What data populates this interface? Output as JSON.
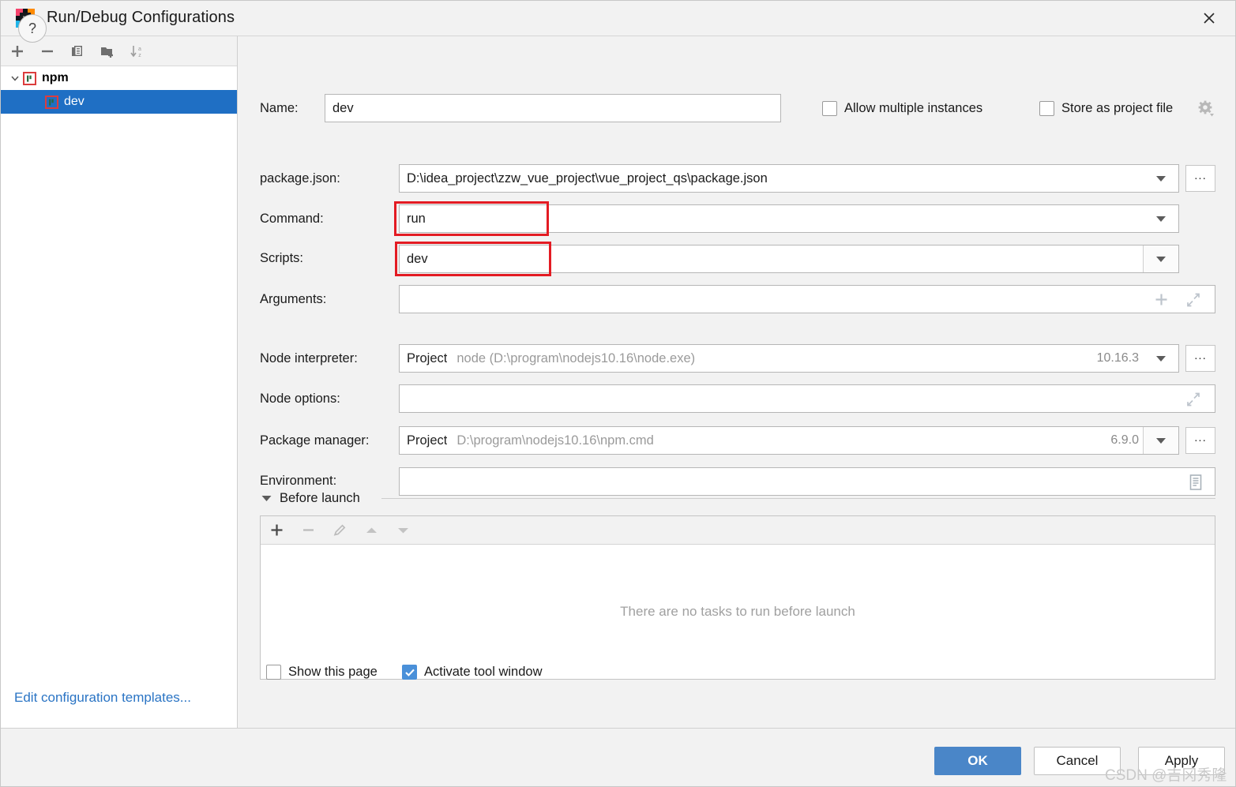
{
  "window": {
    "title": "Run/Debug Configurations",
    "app_icon": "intellij-idea-icon",
    "close_icon": "close-icon"
  },
  "sidebar": {
    "toolbar": [
      {
        "name": "add-configuration-button",
        "icon": "plus-icon"
      },
      {
        "name": "remove-configuration-button",
        "icon": "minus-icon"
      },
      {
        "name": "copy-configuration-button",
        "icon": "copy-icon"
      },
      {
        "name": "new-folder-button",
        "icon": "new-folder-icon"
      },
      {
        "name": "sort-configurations-button",
        "icon": "sort-alphabetically-icon"
      }
    ],
    "tree": [
      {
        "label": "npm",
        "level": 0,
        "expanded": true,
        "selected": false,
        "icon": "npm-icon"
      },
      {
        "label": "dev",
        "level": 1,
        "expanded": false,
        "selected": true,
        "icon": "npm-icon"
      }
    ],
    "edit_templates_link": "Edit configuration templates..."
  },
  "form": {
    "name_label": "Name:",
    "name_value": "dev",
    "allow_multiple_instances": {
      "label": "Allow multiple instances",
      "checked": false
    },
    "store_as_project_file": {
      "label": "Store as project file",
      "checked": false,
      "gear_icon": "gear-icon"
    },
    "package_json_label": "package.json:",
    "package_json_value": "D:\\idea_project\\zzw_vue_project\\vue_project_qs\\package.json",
    "command_label": "Command:",
    "command_value": "run",
    "scripts_label": "Scripts:",
    "scripts_value": "dev",
    "arguments_label": "Arguments:",
    "arguments_value": "",
    "node_interpreter_label": "Node interpreter:",
    "node_interpreter_prefix": "Project",
    "node_interpreter_value": "node (D:\\program\\nodejs10.16\\node.exe)",
    "node_interpreter_version": "10.16.3",
    "node_options_label": "Node options:",
    "node_options_value": "",
    "package_manager_label": "Package manager:",
    "package_manager_prefix": "Project",
    "package_manager_value": "D:\\program\\nodejs10.16\\npm.cmd",
    "package_manager_version": "6.9.0",
    "environment_label": "Environment:",
    "environment_value": "",
    "browse_button_label": "...",
    "highlight_color": "#e31b23"
  },
  "before_launch": {
    "title": "Before launch",
    "collapsed": false,
    "toolbar": [
      {
        "name": "add-task-button",
        "icon": "plus-icon",
        "enabled": true
      },
      {
        "name": "remove-task-button",
        "icon": "minus-icon",
        "enabled": false
      },
      {
        "name": "edit-task-button",
        "icon": "pencil-icon",
        "enabled": false
      },
      {
        "name": "move-task-up-button",
        "icon": "arrow-up-icon",
        "enabled": false
      },
      {
        "name": "move-task-down-button",
        "icon": "arrow-down-icon",
        "enabled": false
      }
    ],
    "empty_message": "There are no tasks to run before launch",
    "show_this_page": {
      "label": "Show this page",
      "checked": false
    },
    "activate_tool_window": {
      "label": "Activate tool window",
      "checked": true
    }
  },
  "footer": {
    "help_icon": "question-mark-icon",
    "ok_label": "OK",
    "cancel_label": "Cancel",
    "apply_label": "Apply",
    "watermark": "CSDN @吉冈秀隆",
    "accent_color": "#4a86c8"
  }
}
